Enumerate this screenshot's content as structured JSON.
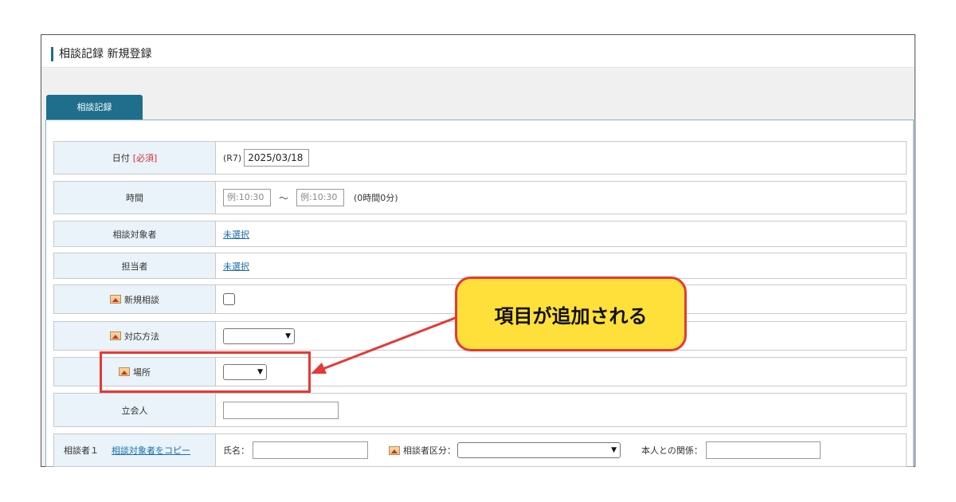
{
  "header": {
    "title": "相談記録 新規登録"
  },
  "tab": {
    "label": "相談記録"
  },
  "rows": {
    "date": {
      "label": "日付",
      "required": "[必須]",
      "era": "(R7)",
      "value": "2025/03/18"
    },
    "time": {
      "label": "時間",
      "start_placeholder": "例:10:30",
      "separator": "～",
      "end_placeholder": "例:10:30",
      "duration": "(0時間0分)"
    },
    "subject": {
      "label": "相談対象者",
      "link": "未選択"
    },
    "staff": {
      "label": "担当者",
      "link": "未選択"
    },
    "new_consult": {
      "label": "新規相談",
      "checked": false
    },
    "method": {
      "label": "対応方法",
      "selected": ""
    },
    "place": {
      "label": "場所",
      "selected": ""
    },
    "attendee": {
      "label": "立会人",
      "value": ""
    },
    "consultant1": {
      "label": "相談者１",
      "copy_link": "相談対象者をコピー",
      "name_label": "氏名：",
      "name_value": "",
      "category_label": "相談者区分：",
      "category_selected": "",
      "relation_label": "本人との関係：",
      "relation_value": ""
    }
  },
  "annotation": {
    "callout_text": "項目が追加される",
    "color": "#e53935",
    "callout_fill": "#ffe03a"
  },
  "colors": {
    "accent": "#1f6e8c",
    "label_bg": "#e9f3f9",
    "link": "#1a6fa8",
    "required": "#d0312d"
  }
}
